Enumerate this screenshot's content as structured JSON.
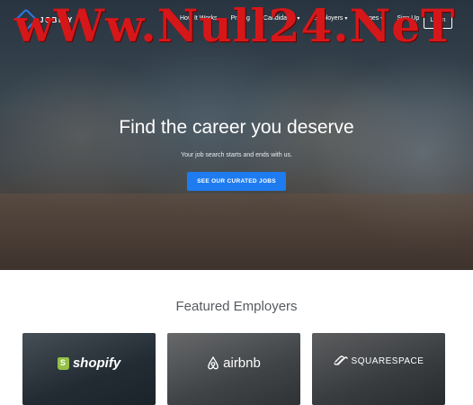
{
  "nav": {
    "logo_text": "JOBIFY",
    "links": [
      {
        "label": "How It Works",
        "dropdown": false
      },
      {
        "label": "Pricing",
        "dropdown": false
      },
      {
        "label": "Candidates",
        "dropdown": true
      },
      {
        "label": "Employers",
        "dropdown": true
      },
      {
        "label": "Pages",
        "dropdown": true
      },
      {
        "label": "Sign Up",
        "dropdown": false
      }
    ],
    "login_label": "Login"
  },
  "watermark": "wWw.Null24.NeT",
  "hero": {
    "title": "Find the career you deserve",
    "subtitle": "Your job search starts and ends with us.",
    "cta_label": "SEE OUR CURATED JOBS"
  },
  "featured": {
    "title": "Featured Employers",
    "employers": [
      {
        "name": "shopify"
      },
      {
        "name": "airbnb"
      },
      {
        "name": "SQUARESPACE"
      }
    ]
  },
  "colors": {
    "accent": "#1e7cf0",
    "watermark": "#d6171a",
    "shopify_green": "#95bf47"
  }
}
